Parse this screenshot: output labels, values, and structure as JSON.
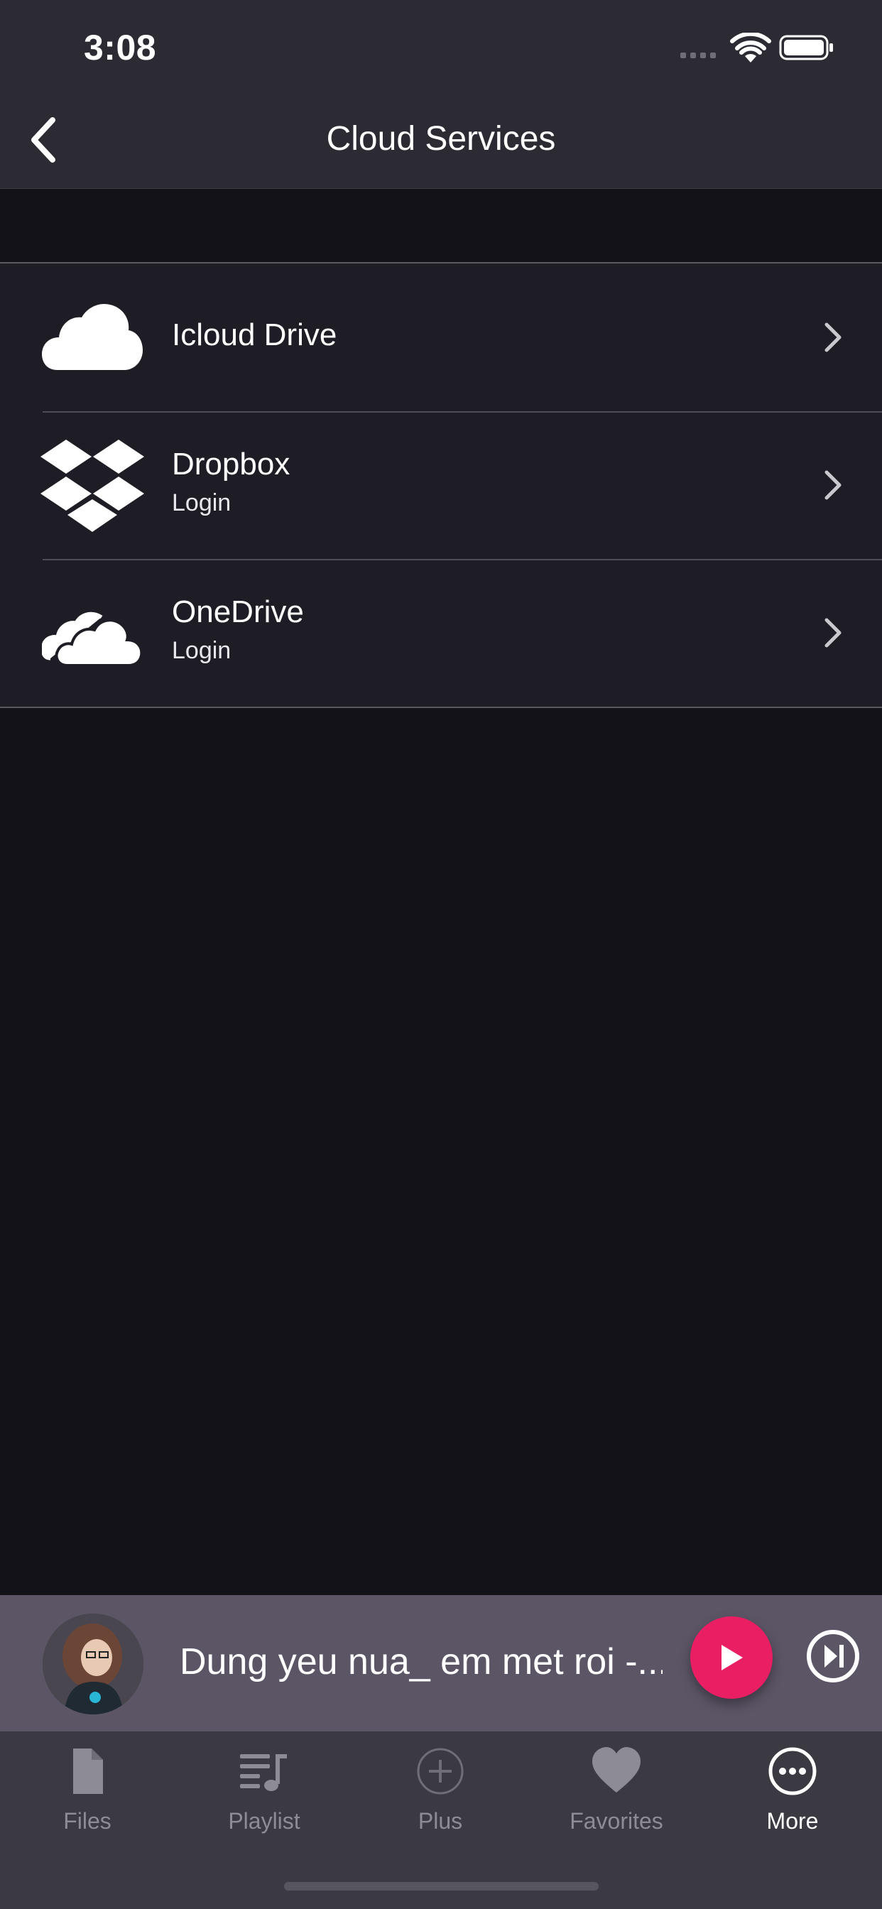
{
  "status_bar": {
    "time": "3:08"
  },
  "nav": {
    "title": "Cloud Services",
    "back_icon": "chevron-left-icon"
  },
  "cloud_list": [
    {
      "title": "Icloud Drive",
      "subtitle": "",
      "icon": "icloud-icon"
    },
    {
      "title": "Dropbox",
      "subtitle": "Login",
      "icon": "dropbox-icon"
    },
    {
      "title": "OneDrive",
      "subtitle": "Login",
      "icon": "onedrive-icon"
    }
  ],
  "player": {
    "song_title": "Dung yeu nua_ em met roi -...",
    "accent_color": "#e91e63"
  },
  "tabs": [
    {
      "label": "Files",
      "icon": "file-icon",
      "active": false
    },
    {
      "label": "Playlist",
      "icon": "playlist-icon",
      "active": false
    },
    {
      "label": "Plus",
      "icon": "plus-circle-icon",
      "active": false
    },
    {
      "label": "Favorites",
      "icon": "heart-icon",
      "active": false
    },
    {
      "label": "More",
      "icon": "more-icon",
      "active": true
    }
  ]
}
